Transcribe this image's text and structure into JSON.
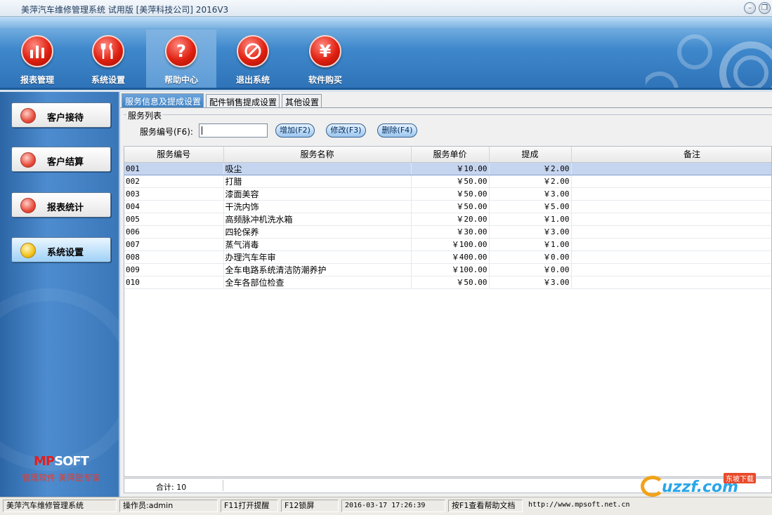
{
  "window": {
    "title": "美萍汽车维修管理系统 试用版 [美萍科技公司] 2016V3"
  },
  "toolbar": {
    "items": [
      {
        "label": "报表管理",
        "icon": "bar-chart-icon",
        "glyph": "▮"
      },
      {
        "label": "系统设置",
        "icon": "tools-icon",
        "glyph": "ΨΨ"
      },
      {
        "label": "帮助中心",
        "icon": "help-icon",
        "glyph": "?"
      },
      {
        "label": "退出系统",
        "icon": "prohibit-icon",
        "glyph": "⊘"
      },
      {
        "label": "软件购买",
        "icon": "yen-icon",
        "glyph": "¥"
      }
    ]
  },
  "sidebar": {
    "buttons": [
      {
        "label": "客户接待"
      },
      {
        "label": "客户结算"
      },
      {
        "label": "报表统计"
      },
      {
        "label": "系统设置"
      }
    ],
    "logo_text": "MPSOFT",
    "slogan": "管理软件 美萍是专家"
  },
  "tabs": [
    {
      "label": "服务信息及提成设置"
    },
    {
      "label": "配件销售提成设置"
    },
    {
      "label": "其他设置"
    }
  ],
  "form": {
    "group_label": "服务列表",
    "code_label": "服务编号(F6):",
    "code_value": "",
    "add_label": "增加(F2)",
    "edit_label": "修改(F3)",
    "delete_label": "删除(F4)"
  },
  "table": {
    "columns": [
      "服务编号",
      "服务名称",
      "服务单价",
      "提成",
      "备注"
    ],
    "rows": [
      {
        "code": "001",
        "name": "吸尘",
        "price": "￥10.00",
        "commission": "￥2.00",
        "note": ""
      },
      {
        "code": "002",
        "name": "打腊",
        "price": "￥50.00",
        "commission": "￥2.00",
        "note": ""
      },
      {
        "code": "003",
        "name": "漆面美容",
        "price": "￥50.00",
        "commission": "￥3.00",
        "note": ""
      },
      {
        "code": "004",
        "name": "干洗内饰",
        "price": "￥50.00",
        "commission": "￥5.00",
        "note": ""
      },
      {
        "code": "005",
        "name": "高频脉冲机洗水箱",
        "price": "￥20.00",
        "commission": "￥1.00",
        "note": ""
      },
      {
        "code": "006",
        "name": "四轮保养",
        "price": "￥30.00",
        "commission": "￥3.00",
        "note": ""
      },
      {
        "code": "007",
        "name": "蒸气消毒",
        "price": "￥100.00",
        "commission": "￥1.00",
        "note": ""
      },
      {
        "code": "008",
        "name": "办理汽车年审",
        "price": "￥400.00",
        "commission": "￥0.00",
        "note": ""
      },
      {
        "code": "009",
        "name": "全车电路系统清洁防潮养护",
        "price": "￥100.00",
        "commission": "￥0.00",
        "note": ""
      },
      {
        "code": "010",
        "name": "全车各部位检查",
        "price": "￥50.00",
        "commission": "￥3.00",
        "note": ""
      }
    ],
    "total_label": "合计: 10"
  },
  "statusbar": {
    "app_name": "美萍汽车维修管理系统",
    "operator": "操作员:admin",
    "f11": "F11打开提醒",
    "f12": "F12锁屏",
    "datetime": "2016-03-17 17:26:39",
    "help": "按F1查看帮助文档",
    "url": "http://www.mpsoft.net.cn"
  },
  "watermark": {
    "text": "uzzf.com",
    "badge": "东坡下载"
  },
  "colors": {
    "toolbar_blue": "#3f88cc",
    "sidebar_blue": "#4d8ccf",
    "selected_row": "#c6d5ef",
    "icon_red": "#e02010"
  }
}
